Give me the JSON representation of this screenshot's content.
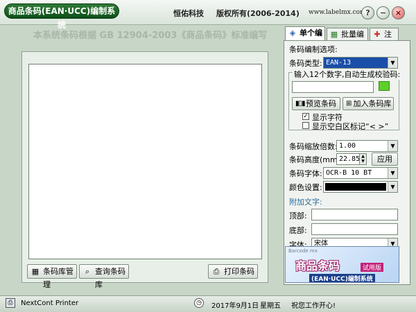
{
  "window": {
    "app_title": "商品条码(EAN·UCC)编制系统",
    "company": "恒佑科技",
    "copyright": "版权所有(2006-2014)",
    "website": "www.labelmx.com",
    "help_glyph": "?",
    "minimize_glyph": "−",
    "close_glyph": "×"
  },
  "banner": "本系统条码根据 GB 12904-2003《商品条码》标准编写",
  "bottom_buttons": {
    "manage": "条码库管理",
    "query": "查询条码库",
    "print": "打印条码"
  },
  "tabs": [
    {
      "label": "单个编制"
    },
    {
      "label": "批量编制"
    },
    {
      "label": "注册"
    }
  ],
  "panel": {
    "options_title": "条码编制选项:",
    "type_label": "条码类型:",
    "type_value": "EAN-13",
    "input_hint": "输入12个数字,自动生成校验码:",
    "digits_value": "",
    "preview_btn": "预览条码",
    "add_btn": "加入条码库",
    "show_chars": "显示字符",
    "show_blank": "显示空白区标记“< >”",
    "scale_label": "条码缩放倍数:",
    "scale_value": "1.00",
    "height_label": "条码高度(mm):",
    "height_value": "22.85",
    "apply_btn": "应用",
    "font_label": "条码字体:",
    "font_value": "OCR-B 10 BT",
    "color_label": "颜色设置:",
    "extra_text_title": "附加文字:",
    "top_label": "顶部:",
    "top_value": "",
    "bottom_label": "底部:",
    "bottom_value": "",
    "font2_label": "字体:",
    "font2_value": "宋体"
  },
  "logo": {
    "small": "Barcode mx",
    "title": "商品条码",
    "trial": "试用版",
    "subtitle": "(EAN·UCC)编制系统"
  },
  "status": {
    "printer": "NextCont Printer",
    "date": "2017年9月1日",
    "weekday": "星期五",
    "greeting": "祝您工作开心!"
  },
  "colors": {
    "accent": "#0d4f1a",
    "barcode_color": "#000000",
    "check_green": "#5dcf2a"
  }
}
